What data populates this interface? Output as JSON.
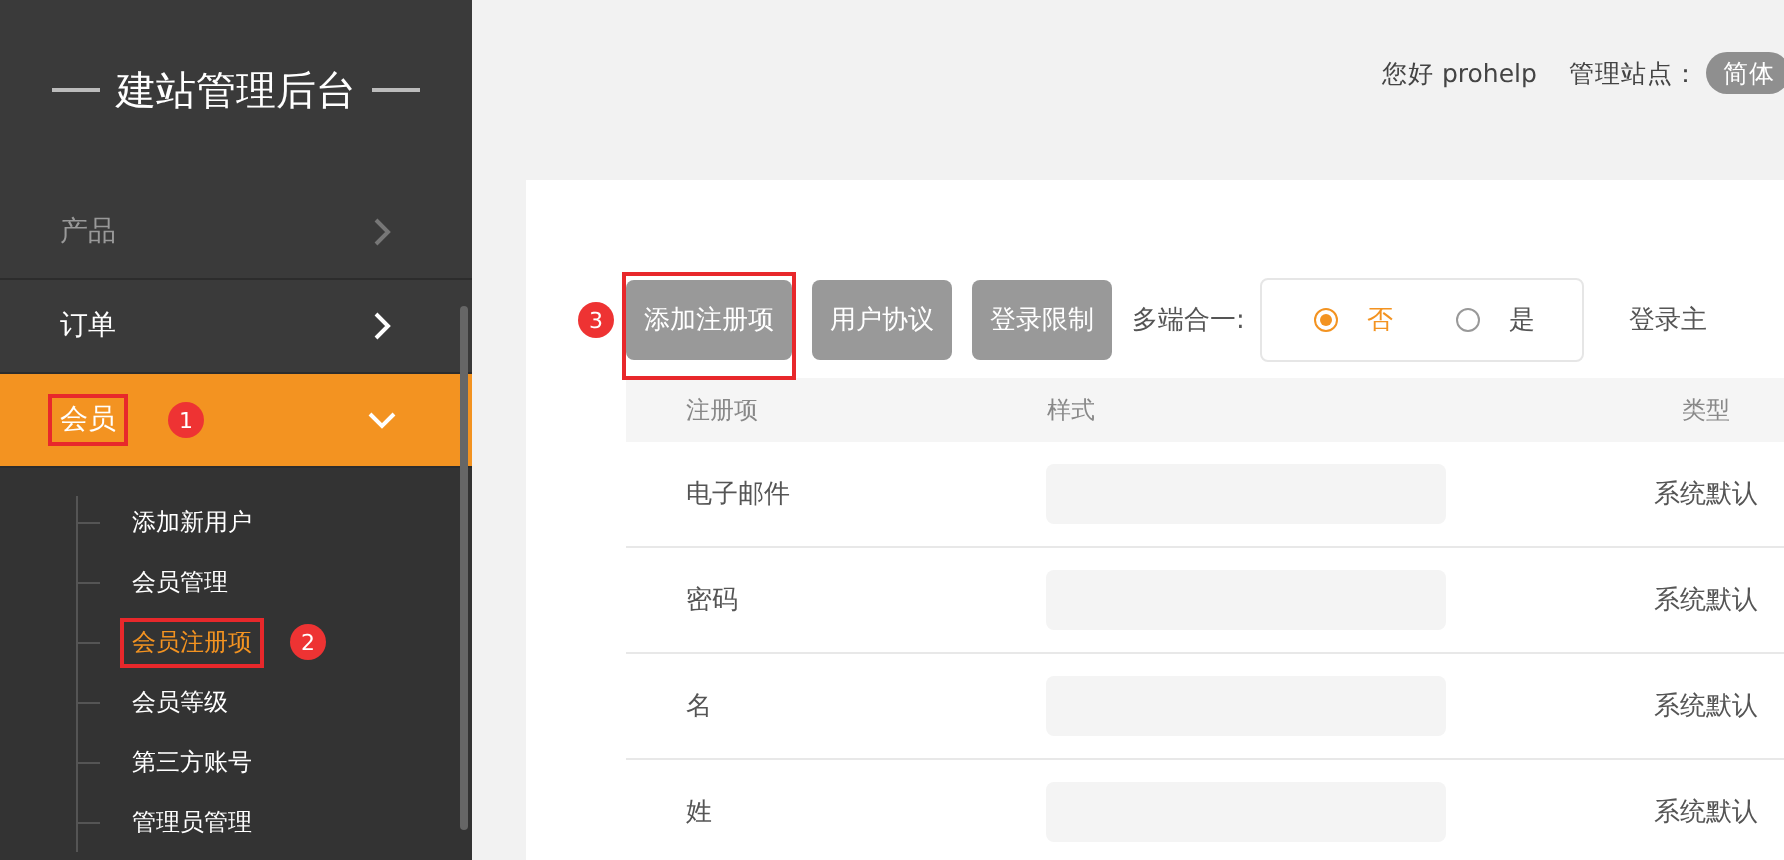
{
  "sidebar": {
    "title": "建站管理后台",
    "items": [
      {
        "label": "产品",
        "expanded": false,
        "selected": false,
        "disabled": true
      },
      {
        "label": "订单",
        "expanded": false,
        "selected": false,
        "disabled": false
      },
      {
        "label": "会员",
        "expanded": true,
        "selected": true,
        "disabled": false,
        "boxed": true,
        "callout": "1",
        "children": [
          {
            "label": "添加新用户",
            "selected": false
          },
          {
            "label": "会员管理",
            "selected": false
          },
          {
            "label": "会员注册项",
            "selected": true,
            "boxed": true,
            "callout": "2"
          },
          {
            "label": "会员等级",
            "selected": false
          },
          {
            "label": "第三方账号",
            "selected": false
          },
          {
            "label": "管理员管理",
            "selected": false
          }
        ]
      }
    ]
  },
  "top_bar": {
    "greeting": "您好 prohelp",
    "site_label": "管理站点：",
    "site": "简体"
  },
  "toolbar": {
    "buttons": [
      {
        "label": "添加注册项",
        "boxed": true,
        "callout": "3"
      },
      {
        "label": "用户协议"
      },
      {
        "label": "登录限制"
      }
    ],
    "merge_label": "多端合一:",
    "options": [
      {
        "label": "否",
        "selected": true
      },
      {
        "label": "是",
        "selected": false
      }
    ],
    "login_label": "登录主"
  },
  "table": {
    "columns": [
      "注册项",
      "样式",
      "类型"
    ],
    "rows": [
      {
        "name": "电子邮件",
        "type": "系统默认"
      },
      {
        "name": "密码",
        "type": "系统默认"
      },
      {
        "name": "名",
        "type": "系统默认"
      },
      {
        "name": "姓",
        "type": "系统默认"
      }
    ]
  }
}
